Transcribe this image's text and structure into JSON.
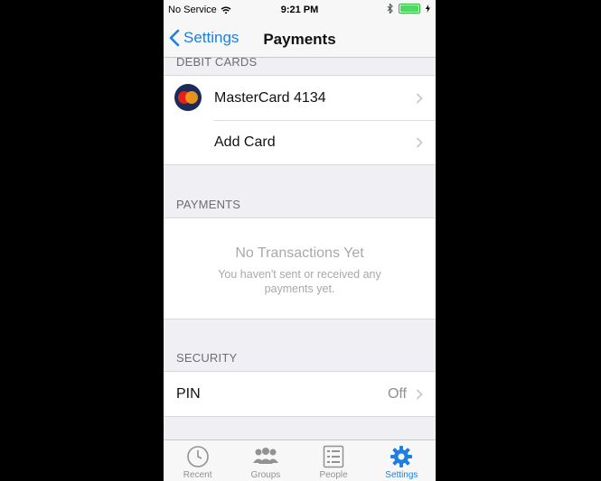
{
  "status_bar": {
    "carrier": "No Service",
    "time": "9:21 PM"
  },
  "nav": {
    "back_label": "Settings",
    "title": "Payments"
  },
  "debit_cards": {
    "header": "DEBIT CARDS",
    "card_label": "MasterCard 4134",
    "add_label": "Add Card"
  },
  "payments": {
    "header": "PAYMENTS",
    "empty_title": "No Transactions Yet",
    "empty_subtitle": "You haven't sent or received any payments yet."
  },
  "security": {
    "header": "SECURITY",
    "pin_label": "PIN",
    "pin_value": "Off"
  },
  "tabs": [
    {
      "label": "Recent",
      "icon": "clock-icon"
    },
    {
      "label": "Groups",
      "icon": "group-icon"
    },
    {
      "label": "People",
      "icon": "list-icon"
    },
    {
      "label": "Settings",
      "icon": "gear-icon",
      "active": true
    }
  ],
  "colors": {
    "accent": "#1f7fe0",
    "background": "#efeff4",
    "battery": "#4cd964"
  }
}
